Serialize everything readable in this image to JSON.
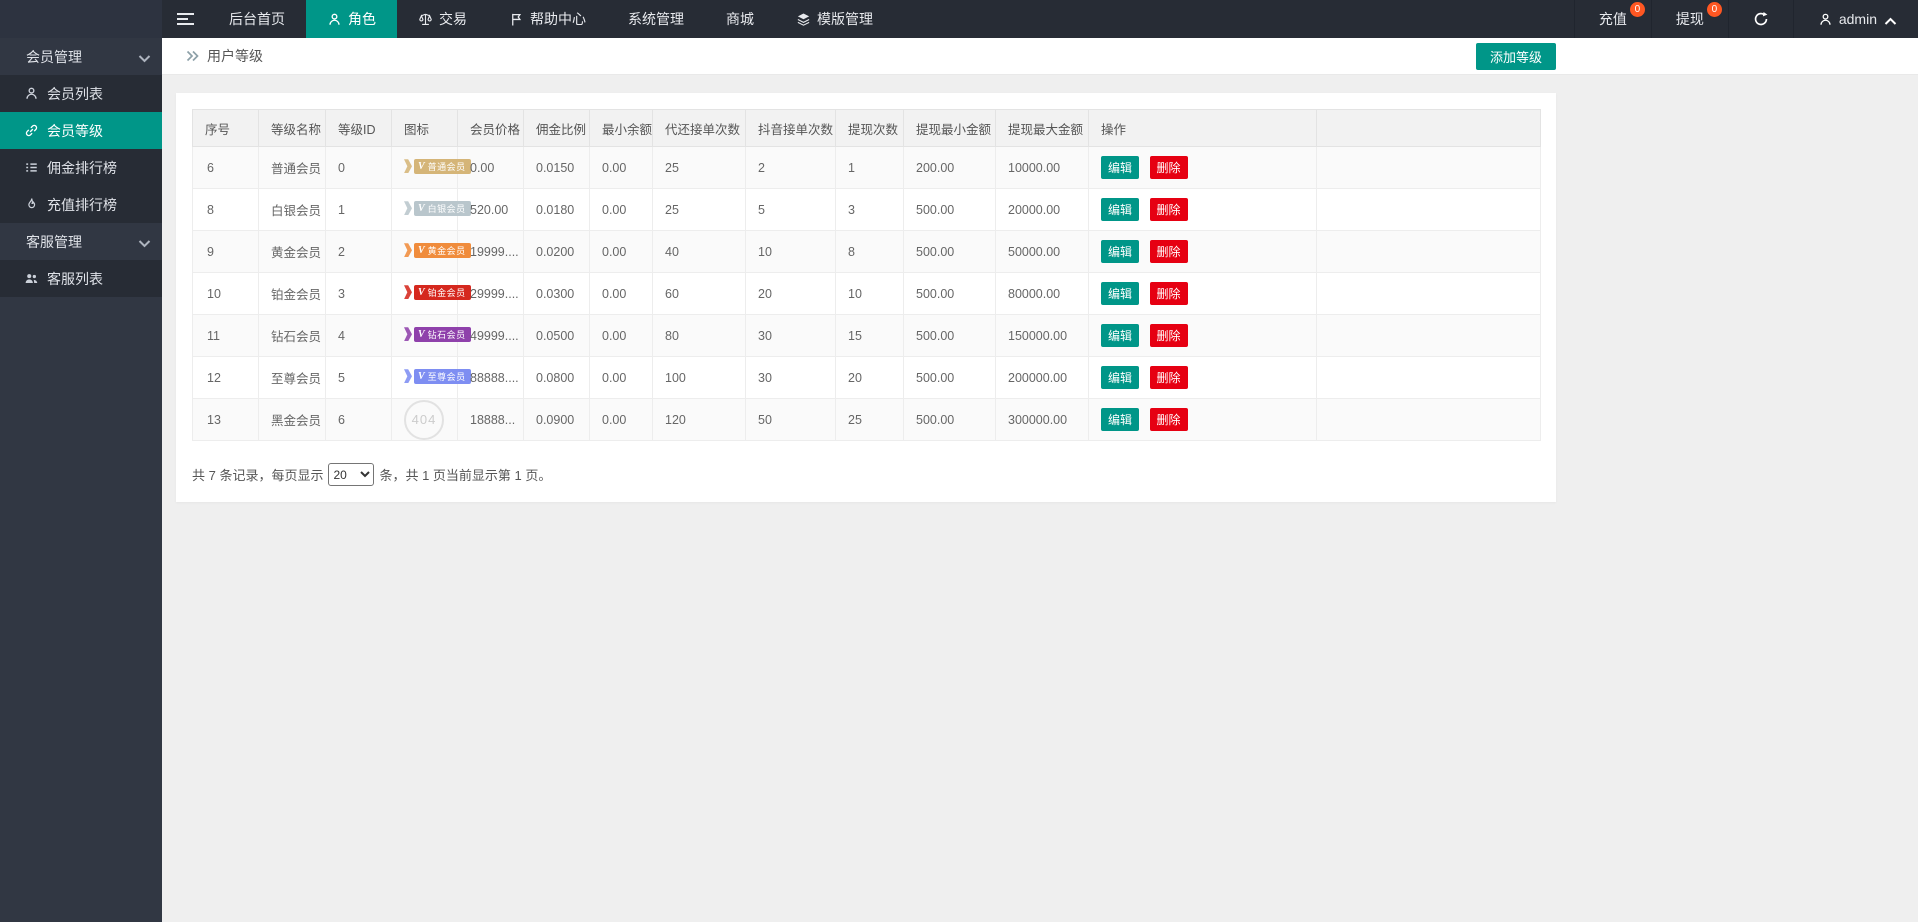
{
  "colors": {
    "accent": "#009688",
    "danger": "#e60012",
    "count_badge": "#ff5722",
    "navbar_bg": "#272c35",
    "sidebar_bg": "#313743",
    "body_bg": "#efefef"
  },
  "navbar": {
    "menu": [
      {
        "label": "后台首页",
        "icon": null,
        "active": false
      },
      {
        "label": "角色",
        "icon": "user-icon",
        "active": true
      },
      {
        "label": "交易",
        "icon": "scales-icon",
        "active": false
      },
      {
        "label": "帮助中心",
        "icon": "flag-icon",
        "active": false
      },
      {
        "label": "系统管理",
        "icon": null,
        "active": false
      },
      {
        "label": "商城",
        "icon": null,
        "active": false
      },
      {
        "label": "模版管理",
        "icon": "layers-icon",
        "active": false
      }
    ],
    "right": {
      "recharge": {
        "label": "充值",
        "badge": "0"
      },
      "withdraw": {
        "label": "提现",
        "badge": "0"
      },
      "user": {
        "name": "admin"
      }
    }
  },
  "sidebar": {
    "items": [
      {
        "label": "会员管理",
        "type": "group"
      },
      {
        "label": "会员列表",
        "icon": "user-icon",
        "active": false
      },
      {
        "label": "会员等级",
        "icon": "link-icon",
        "active": true
      },
      {
        "label": "佣金排行榜",
        "icon": "ranking-list-icon",
        "active": false
      },
      {
        "label": "充值排行榜",
        "icon": "flame-icon",
        "active": false
      },
      {
        "label": "客服管理",
        "type": "group"
      },
      {
        "label": "客服列表",
        "icon": "users-icon",
        "active": false
      }
    ]
  },
  "breadcrumb": {
    "title": "用户等级"
  },
  "toolbar": {
    "add_button_label": "添加等级"
  },
  "table": {
    "badge_v": "V",
    "columns": [
      "序号",
      "等级名称",
      "等级ID",
      "图标",
      "会员价格",
      "佣金比例",
      "最小余额",
      "代还接单次数",
      "抖音接单次数",
      "提现次数",
      "提现最小金额",
      "提现最大金额",
      "操作",
      ""
    ],
    "actions": {
      "edit": "编辑",
      "delete": "删除"
    },
    "rows": [
      {
        "seq": "6",
        "name": "普通会员",
        "level_id": "0",
        "icon": {
          "type": "badge",
          "label": "普通会员",
          "color": "#d5b578"
        },
        "price": "0.00",
        "commission_rate": "0.0150",
        "min_balance": "0.00",
        "repay_orders": "25",
        "douyin_orders": "2",
        "withdraw_times": "1",
        "withdraw_min": "200.00",
        "withdraw_max": "10000.00"
      },
      {
        "seq": "8",
        "name": "白银会员",
        "level_id": "1",
        "icon": {
          "type": "badge",
          "label": "白银会员",
          "color": "#b9c6cc"
        },
        "price": "520.00",
        "commission_rate": "0.0180",
        "min_balance": "0.00",
        "repay_orders": "25",
        "douyin_orders": "5",
        "withdraw_times": "3",
        "withdraw_min": "500.00",
        "withdraw_max": "20000.00"
      },
      {
        "seq": "9",
        "name": "黄金会员",
        "level_id": "2",
        "icon": {
          "type": "badge",
          "label": "黄金会员",
          "color": "#f08c3c"
        },
        "price": "19999....",
        "commission_rate": "0.0200",
        "min_balance": "0.00",
        "repay_orders": "40",
        "douyin_orders": "10",
        "withdraw_times": "8",
        "withdraw_min": "500.00",
        "withdraw_max": "50000.00"
      },
      {
        "seq": "10",
        "name": "铂金会员",
        "level_id": "3",
        "icon": {
          "type": "badge",
          "label": "铂金会员",
          "color": "#d5281e"
        },
        "price": "29999....",
        "commission_rate": "0.0300",
        "min_balance": "0.00",
        "repay_orders": "60",
        "douyin_orders": "20",
        "withdraw_times": "10",
        "withdraw_min": "500.00",
        "withdraw_max": "80000.00"
      },
      {
        "seq": "11",
        "name": "钻石会员",
        "level_id": "4",
        "icon": {
          "type": "badge",
          "label": "钻石会员",
          "color": "#8f41ab"
        },
        "price": "49999....",
        "commission_rate": "0.0500",
        "min_balance": "0.00",
        "repay_orders": "80",
        "douyin_orders": "30",
        "withdraw_times": "15",
        "withdraw_min": "500.00",
        "withdraw_max": "150000.00"
      },
      {
        "seq": "12",
        "name": "至尊会员",
        "level_id": "5",
        "icon": {
          "type": "badge",
          "label": "至尊会员",
          "color": "#7e8ef2"
        },
        "price": "88888....",
        "commission_rate": "0.0800",
        "min_balance": "0.00",
        "repay_orders": "100",
        "douyin_orders": "30",
        "withdraw_times": "20",
        "withdraw_min": "500.00",
        "withdraw_max": "200000.00"
      },
      {
        "seq": "13",
        "name": "黑金会员",
        "level_id": "6",
        "icon": {
          "type": "404",
          "label": "404"
        },
        "price": "18888...",
        "commission_rate": "0.0900",
        "min_balance": "0.00",
        "repay_orders": "120",
        "douyin_orders": "50",
        "withdraw_times": "25",
        "withdraw_min": "500.00",
        "withdraw_max": "300000.00"
      }
    ]
  },
  "pagination": {
    "prefix": "共 7 条记录，每页显示",
    "page_size": "20",
    "suffix": "条，共 1 页当前显示第 1 页。"
  }
}
